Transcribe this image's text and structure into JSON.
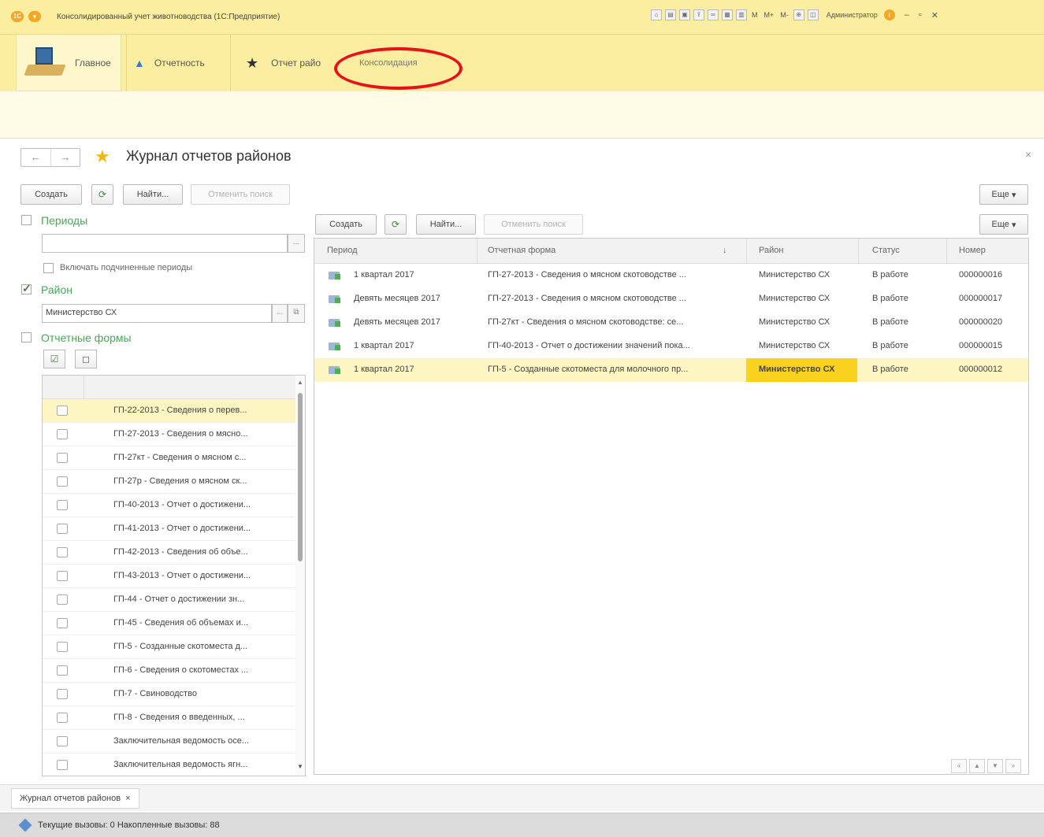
{
  "window": {
    "title": "Консолидированный учет животноводства (1С:Предприятие)",
    "toolbar_texts": [
      "M",
      "M+",
      "M-"
    ],
    "user": "Администратор"
  },
  "sections": {
    "main": "Главное",
    "reports": "Отчетность",
    "district": "Отчет райо",
    "consolidation": "Консолидация",
    "annotation_color": "#e8101a"
  },
  "form": {
    "title": "Журнал отчетов районов",
    "close": "×",
    "nav_back": "←",
    "nav_forward": "→"
  },
  "left_toolbar": {
    "create": "Создать",
    "find": "Найти...",
    "cancel_search": "Отменить поиск"
  },
  "main_toolbar": {
    "create": "Создать",
    "find": "Найти...",
    "cancel_search": "Отменить поиск",
    "more": "Еще"
  },
  "top_more": "Еще",
  "filters": {
    "periods_label": "Периоды",
    "periods_value": "",
    "include_sub_label": "Включать подчиненные периоды",
    "district_label": "Район",
    "district_value": "Министерство СХ",
    "report_forms_label": "Отчетные формы",
    "report_forms": [
      "ГП-22-2013 - Сведения о перев...",
      "ГП-27-2013 - Сведения о мясно...",
      "ГП-27кт - Сведения о мясном с...",
      "ГП-27р - Сведения о мясном ск...",
      "ГП-40-2013 - Отчет о достижени...",
      "ГП-41-2013 - Отчет о достижени...",
      "ГП-42-2013 - Сведения об объе...",
      "ГП-43-2013 - Отчет о достижени...",
      "ГП-44 - Отчет о достижении зн...",
      "ГП-45 - Сведения об объемах и...",
      "ГП-5 - Созданные скотоместа д...",
      "ГП-6 - Сведения о скотоместах ...",
      "ГП-7 - Свиноводство",
      "ГП-8 - Сведения о введенных, ...",
      "Заключительная ведомость осе...",
      "Заключительная ведомость ягн..."
    ]
  },
  "table": {
    "columns": [
      "Период",
      "Отчетная форма",
      "Район",
      "Статус",
      "Номер"
    ],
    "sort_indicator": "↓",
    "rows": [
      {
        "period": "1 квартал 2017",
        "form": "ГП-27-2013 - Сведения о мясном скотоводстве ...",
        "district": "Министерство СХ",
        "status": "В работе",
        "number": "000000016"
      },
      {
        "period": "Девять месяцев 2017",
        "form": "ГП-27-2013 - Сведения о мясном скотоводстве ...",
        "district": "Министерство СХ",
        "status": "В работе",
        "number": "000000017"
      },
      {
        "period": "Девять месяцев 2017",
        "form": "ГП-27кт - Сведения о мясном скотоводстве: се...",
        "district": "Министерство СХ",
        "status": "В работе",
        "number": "000000020"
      },
      {
        "period": "1 квартал 2017",
        "form": "ГП-40-2013 - Отчет о достижении значений пока...",
        "district": "Министерство СХ",
        "status": "В работе",
        "number": "000000015"
      },
      {
        "period": "1 квартал 2017",
        "form": "ГП-5 - Созданные скотоместа для молочного пр...",
        "district": "Министерство СХ",
        "status": "В работе",
        "number": "000000012"
      }
    ],
    "pager": [
      "«",
      "▲",
      "▼",
      "»"
    ]
  },
  "open_tab": "Журнал отчетов районов",
  "status": {
    "text": "Текущие вызовы: 0   Накопленные вызовы: 88"
  }
}
